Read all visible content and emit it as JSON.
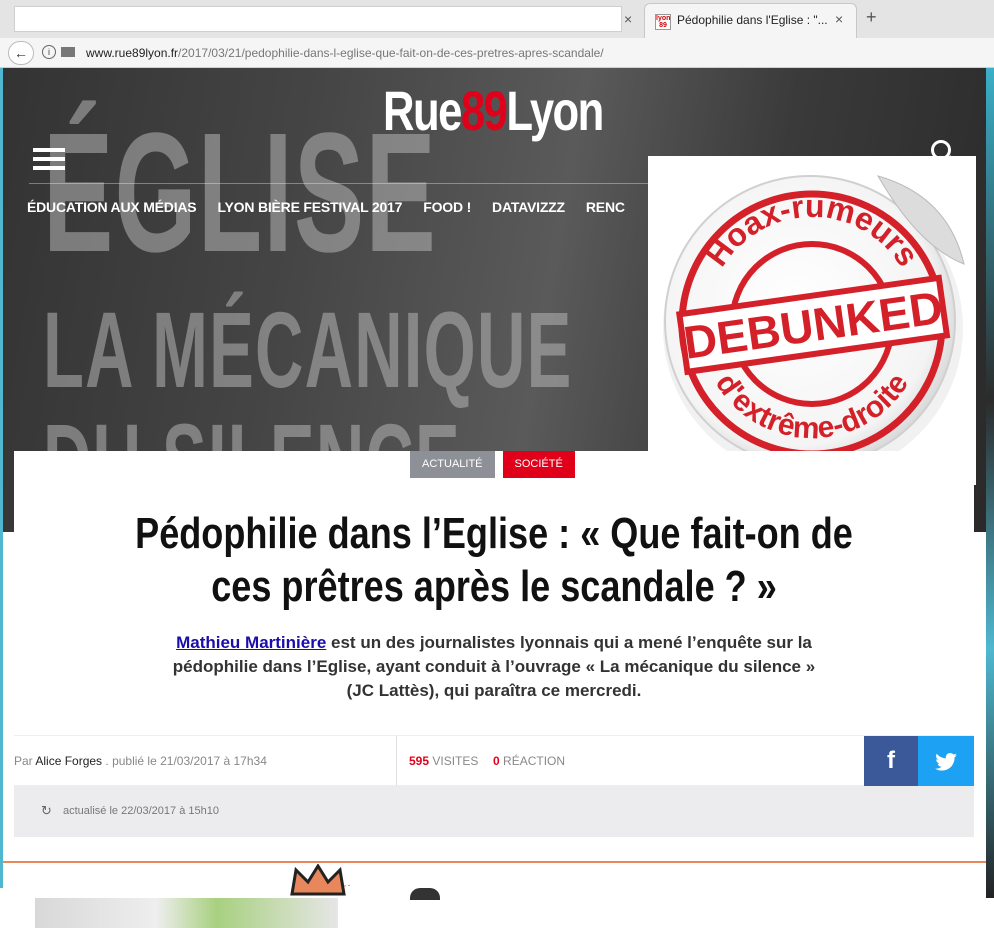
{
  "browser": {
    "active_tab_title": "Pédophilie dans l'Eglise : \"...",
    "favicon_text": "lyon 89",
    "close_glyph": "×",
    "new_tab_glyph": "+",
    "url_host": "www.rue89lyon.fr",
    "url_path": "/2017/03/21/pedophilie-dans-l-eglise-que-fait-on-de-ces-pretres-apres-scandale/"
  },
  "site": {
    "logo_part1": "Rue",
    "logo_num": "89",
    "logo_part2": "Lyon",
    "nav": [
      "ÉDUCATION AUX MÉDIAS",
      "LYON BIÈRE FESTIVAL 2017",
      "FOOD !",
      "DATAVIZZZ",
      "RENC"
    ]
  },
  "hero": {
    "line1": "ÉGLISE",
    "line2": "LA MÉCANIQUE",
    "line3": "DU SILENCE"
  },
  "sticker": {
    "top_text": "Hoax-rumeurs",
    "center_text": "DEBUNKED",
    "bottom_text": "d'extrême-droite",
    "color": "#d42028"
  },
  "article": {
    "tags": [
      "ACTUALITÉ",
      "SOCIÉTÉ"
    ],
    "headline_line1": "Pédophilie dans l’Eglise : « Que fait-on de",
    "headline_line2": "ces prêtres après le scandale ? »",
    "lede_link": "Mathieu Martinière",
    "lede_rest": " est un des journalistes lyonnais qui a mené l’enquête sur la pédophilie dans l’Eglise, ayant conduit à l’ouvrage « La mécanique du silence » (JC Lattès), qui paraîtra ce mercredi.",
    "byline_prefix": "Par",
    "author": "Alice Forges",
    "published": ". publié le 21/03/2017 à 17h34",
    "visits_count": "595",
    "visits_label": "VISITES",
    "reactions_count": "0",
    "reactions_label": "RÉACTION",
    "updated": "actualisé le 22/03/2017 à 15h10"
  },
  "colors": {
    "brand_red": "#e1001a",
    "facebook": "#3b5998",
    "twitter": "#1da1f2"
  }
}
